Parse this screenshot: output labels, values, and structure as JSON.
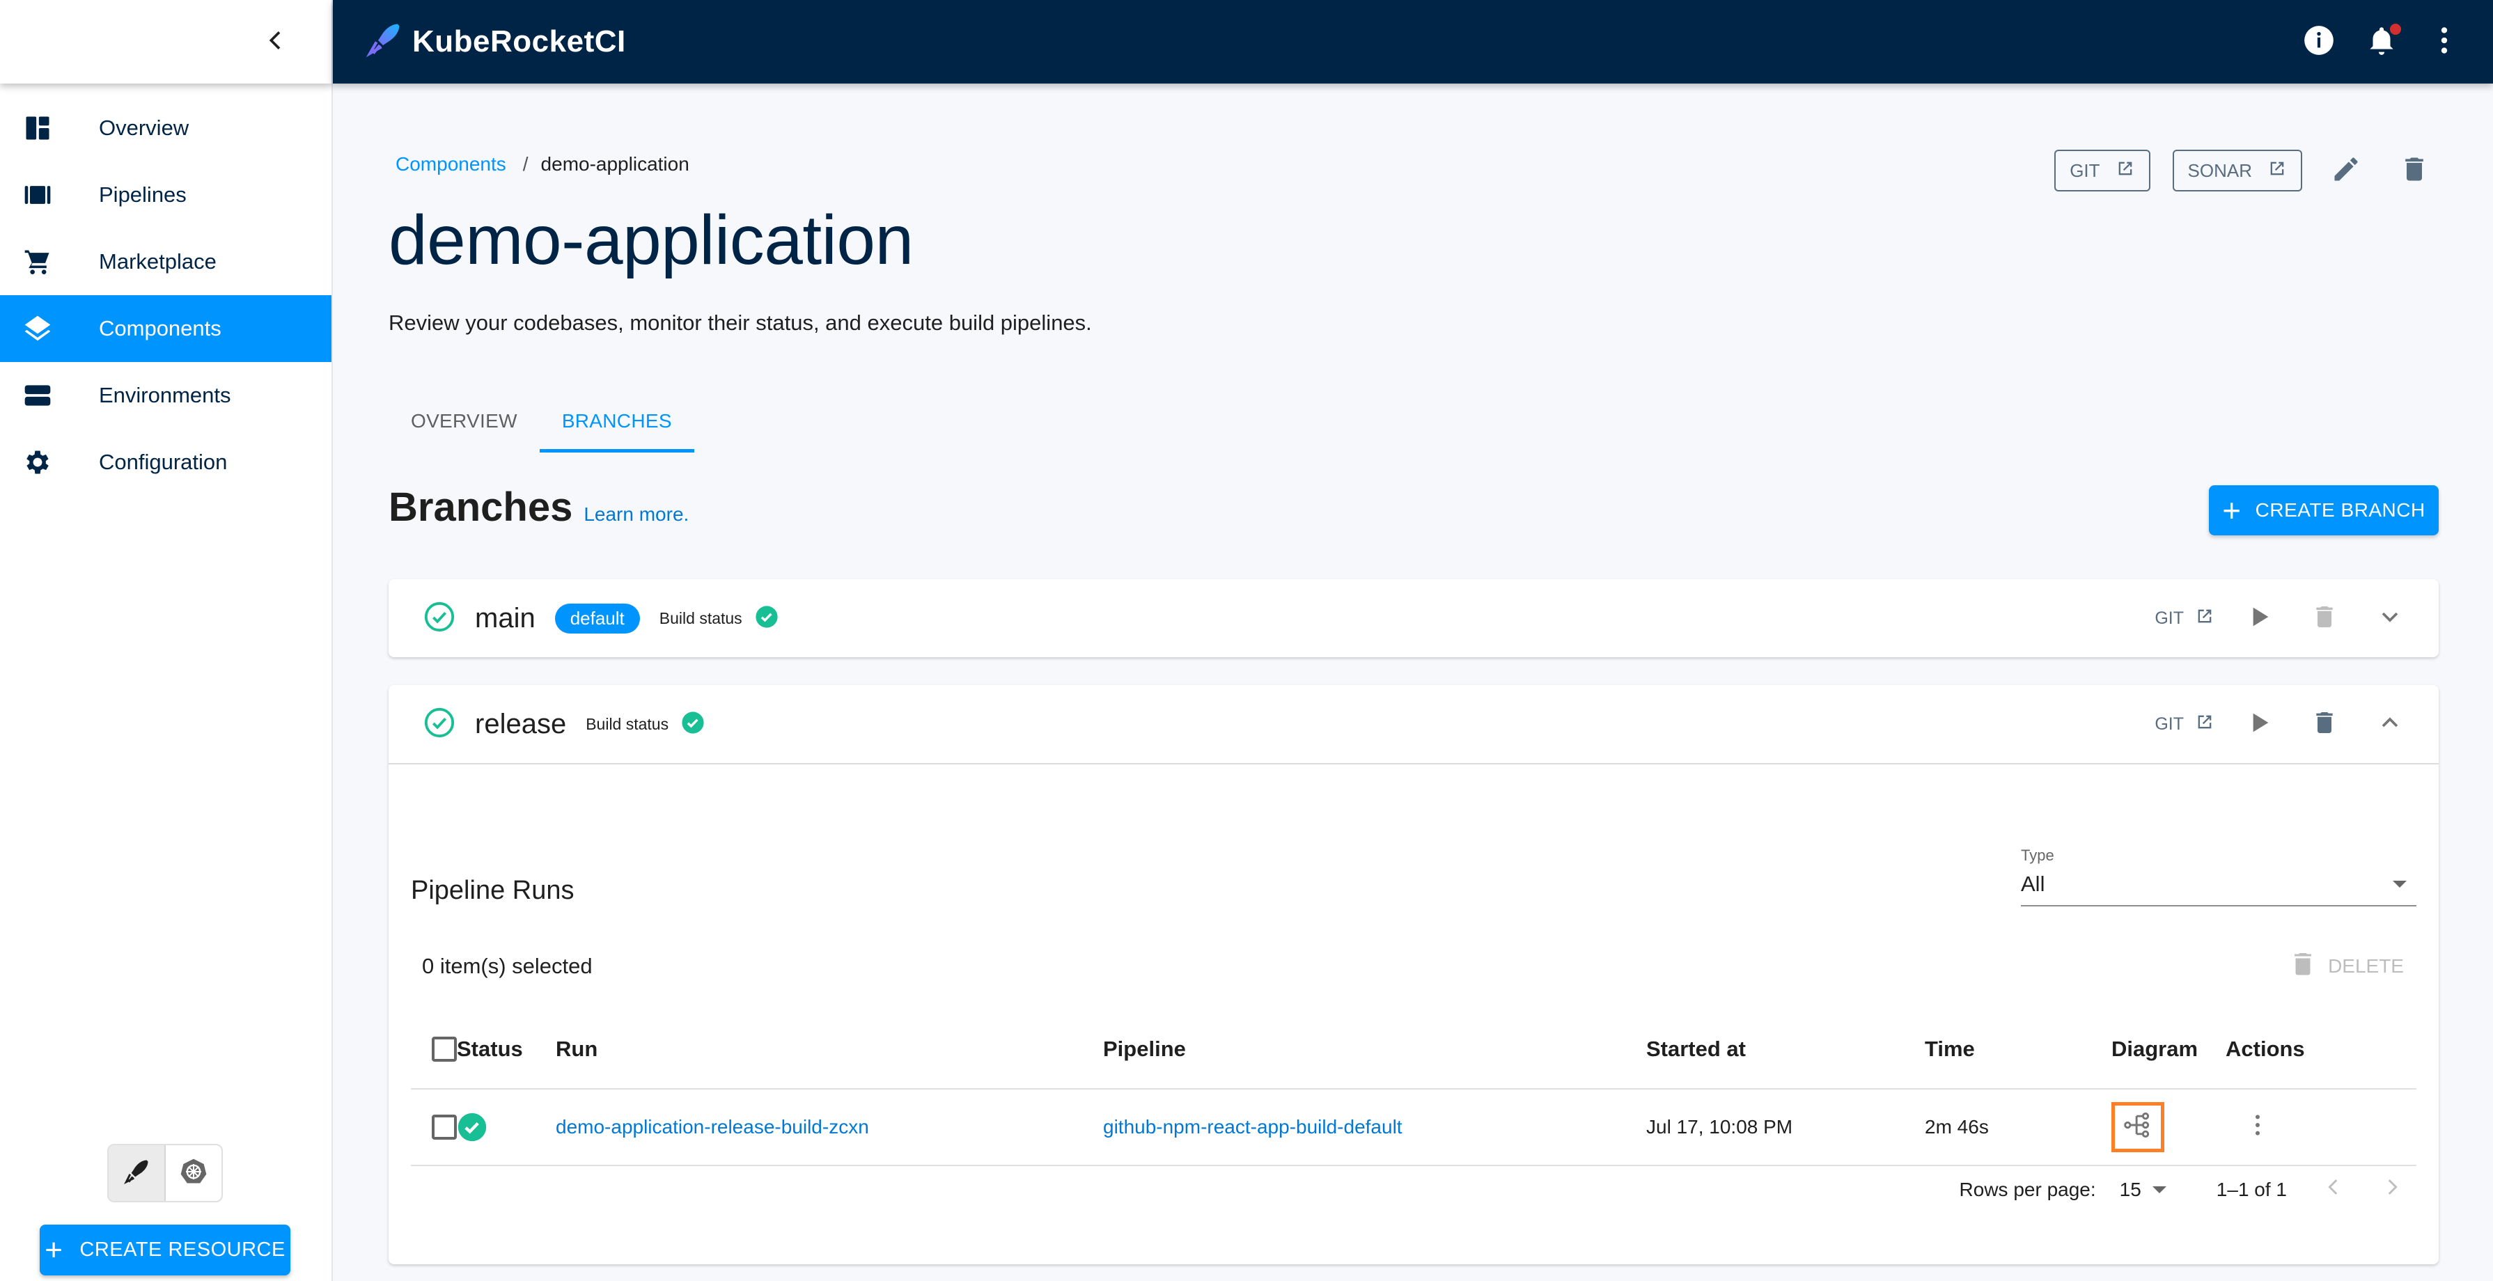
{
  "app": {
    "title": "KubeRocketCI",
    "colors": {
      "header": "#002446",
      "accent": "#0094ff",
      "success": "#18be94",
      "diagram_highlight": "#ff7f27",
      "notification": "#d32f2f"
    }
  },
  "topbar": {
    "icons": [
      "info-icon",
      "bell-icon",
      "more-vertical-icon"
    ],
    "notification_dot": true
  },
  "sidebar": {
    "collapse_icon": "chevron-left-icon",
    "items": [
      {
        "label": "Overview",
        "icon": "dashboard-icon",
        "active": false
      },
      {
        "label": "Pipelines",
        "icon": "pipelines-icon",
        "active": false
      },
      {
        "label": "Marketplace",
        "icon": "cart-icon",
        "active": false
      },
      {
        "label": "Components",
        "icon": "layers-icon",
        "active": true
      },
      {
        "label": "Environments",
        "icon": "storage-icon",
        "active": false
      },
      {
        "label": "Configuration",
        "icon": "gear-icon",
        "active": false
      }
    ],
    "mode_toggle": [
      "krci-icon",
      "kubernetes-icon"
    ],
    "create_resource_label": "CREATE RESOURCE"
  },
  "header": {
    "breadcrumb": {
      "parent": "Components",
      "separator": "/",
      "current": "demo-application"
    },
    "title": "demo-application",
    "description": "Review your codebases, monitor their status, and execute build pipelines.",
    "actions": {
      "git_label": "GIT",
      "sonar_label": "SONAR"
    }
  },
  "tabs": [
    {
      "label": "OVERVIEW",
      "active": false
    },
    {
      "label": "BRANCHES",
      "active": true
    }
  ],
  "branches_section": {
    "title": "Branches",
    "learn_more": "Learn more.",
    "create_label": "CREATE BRANCH"
  },
  "branches": [
    {
      "name": "main",
      "badge": "default",
      "build_status_label": "Build status",
      "build_status": "success",
      "git_label": "GIT",
      "delete_disabled": true,
      "expanded": false
    },
    {
      "name": "release",
      "badge": "",
      "build_status_label": "Build status",
      "build_status": "success",
      "git_label": "GIT",
      "delete_disabled": false,
      "expanded": true
    }
  ],
  "pipeline_runs": {
    "title": "Pipeline Runs",
    "type_filter": {
      "label": "Type",
      "value": "All"
    },
    "selected_count": "0 item(s) selected",
    "delete_label": "DELETE",
    "columns": [
      "Status",
      "Run",
      "Pipeline",
      "Started at",
      "Time",
      "Diagram",
      "Actions"
    ],
    "rows": [
      {
        "status": "success",
        "run": "demo-application-release-build-zcxn",
        "pipeline": "github-npm-react-app-build-default",
        "started_at": "Jul 17, 10:08 PM",
        "time": "2m 46s"
      }
    ],
    "pagination": {
      "rows_per_page_label": "Rows per page:",
      "rows_per_page": "15",
      "range": "1–1 of 1"
    }
  }
}
